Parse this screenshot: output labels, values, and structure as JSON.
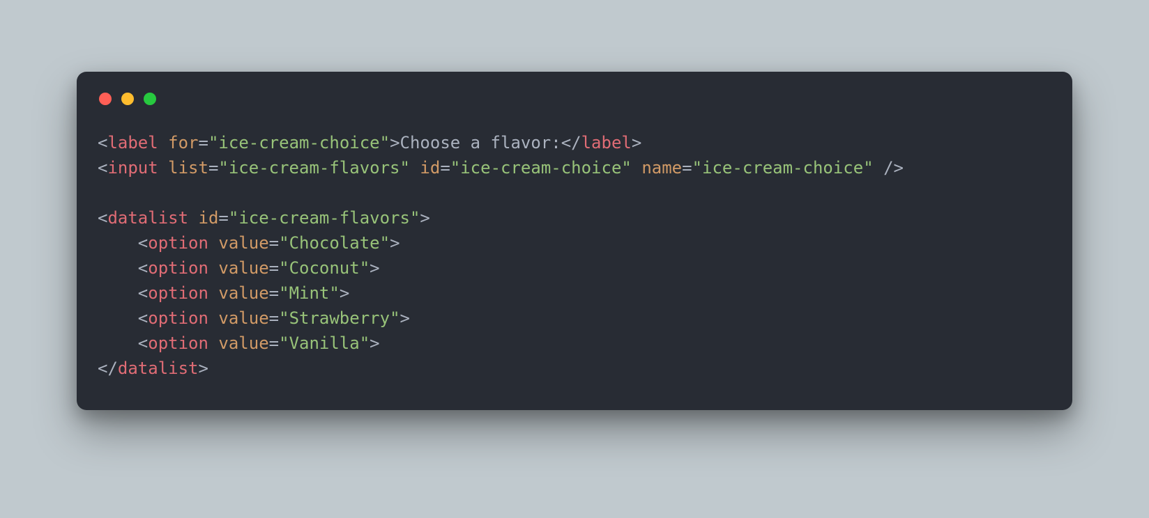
{
  "code": {
    "label_tag": "label",
    "label_attr_for": "for",
    "label_for_value": "ice-cream-choice",
    "label_text": "Choose a flavor:",
    "input_tag": "input",
    "input_attr_list": "list",
    "input_list_value": "ice-cream-flavors",
    "input_attr_id": "id",
    "input_id_value": "ice-cream-choice",
    "input_attr_name": "name",
    "input_name_value": "ice-cream-choice",
    "datalist_tag": "datalist",
    "datalist_attr_id": "id",
    "datalist_id_value": "ice-cream-flavors",
    "option_tag": "option",
    "option_attr_value": "value",
    "options": {
      "o1": "Chocolate",
      "o2": "Coconut",
      "o3": "Mint",
      "o4": "Strawberry",
      "o5": "Vanilla"
    }
  },
  "colors": {
    "background_page": "#c0c9ce",
    "background_window": "#282c34",
    "tag": "#e06c75",
    "attr": "#d19a66",
    "string": "#98c379",
    "text": "#abb2bf",
    "traffic_red": "#ff5f56",
    "traffic_yellow": "#ffbd2e",
    "traffic_green": "#27c93f"
  }
}
